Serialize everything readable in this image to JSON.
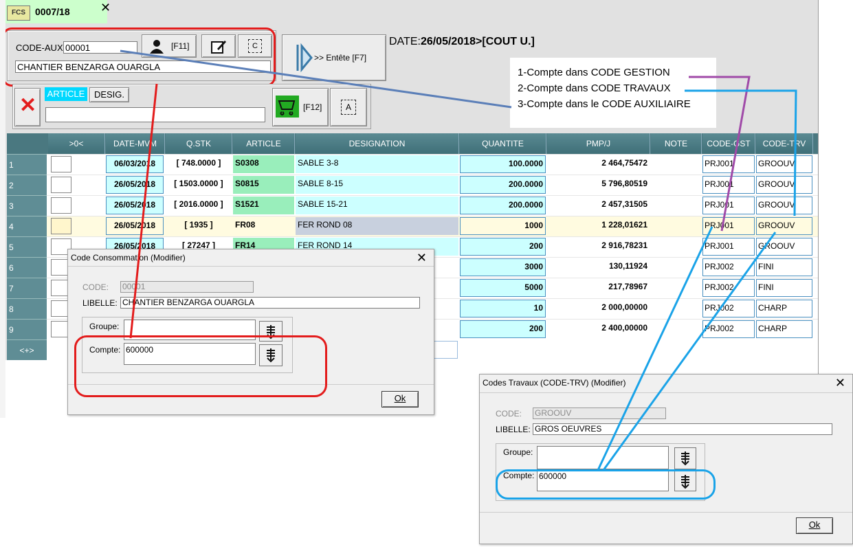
{
  "tab": {
    "title": "0007/18",
    "close": "✕",
    "icon": "FCS"
  },
  "header": {
    "code_aux_label": "CODE-AUX:",
    "code_aux_value": "00001",
    "client_name": "CHANTIER BENZARGA OUARGLA",
    "f11": "[F11]",
    "entete_btn": ">> Entête [F7]",
    "date_label": "DATE:",
    "date_value": "26/05/2018>[COUT U.]",
    "article_tab": "ARTICLE",
    "desig_tab": "DESIG.",
    "f12": "[F12]",
    "btn_c": "C",
    "btn_a": "A"
  },
  "annotation": [
    "1-Compte dans CODE GESTION",
    "2-Compte dans CODE TRAVAUX",
    "3-Compte dans le CODE AUXILIAIRE"
  ],
  "grid": {
    "columns": [
      ">0<",
      "DATE-MVM",
      "Q.STK",
      "ARTICLE",
      "DESIGNATION",
      "QUANTITE",
      "PMP/J",
      "NOTE",
      "CODE-GST",
      "CODE-TRV"
    ],
    "rows": [
      {
        "n": "1",
        "date": "06/03/2018",
        "qstk": "[ 748.0000 ]",
        "article": "S0308",
        "desig": "SABLE 3-8",
        "qte": "100.0000",
        "pmp": "2 464,75472",
        "note": "",
        "gst": "PRJ001",
        "trv": "GROOUV"
      },
      {
        "n": "2",
        "date": "26/05/2018",
        "qstk": "[ 1503.0000 ]",
        "article": "S0815",
        "desig": "SABLE 8-15",
        "qte": "200.0000",
        "pmp": "5 796,80519",
        "note": "",
        "gst": "PRJ001",
        "trv": "GROOUV"
      },
      {
        "n": "3",
        "date": "26/05/2018",
        "qstk": "[ 2016.0000 ]",
        "article": "S1521",
        "desig": "SABLE 15-21",
        "qte": "200.0000",
        "pmp": "2 457,31505",
        "note": "",
        "gst": "PRJ001",
        "trv": "GROOUV"
      },
      {
        "n": "4",
        "date": "26/05/2018",
        "qstk": "[ 1935 ]",
        "article": "FR08",
        "desig": "FER ROND 08",
        "qte": "1000",
        "pmp": "1 228,01621",
        "note": "",
        "gst": "PRJ001",
        "trv": "GROOUV"
      },
      {
        "n": "5",
        "date": "26/05/2018",
        "qstk": "[ 27247 ]",
        "article": "FR14",
        "desig": "FER ROND 14",
        "qte": "200",
        "pmp": "2 916,78231",
        "note": "",
        "gst": "PRJ001",
        "trv": "GROOUV"
      },
      {
        "n": "6",
        "date": "",
        "qstk": "",
        "article": "",
        "desig": "",
        "qte": "3000",
        "pmp": "130,11924",
        "note": "",
        "gst": "PRJ002",
        "trv": "FINI"
      },
      {
        "n": "7",
        "date": "",
        "qstk": "",
        "article": "",
        "desig": "",
        "qte": "5000",
        "pmp": "217,78967",
        "note": "",
        "gst": "PRJ002",
        "trv": "FINI"
      },
      {
        "n": "8",
        "date": "",
        "qstk": "",
        "article": "",
        "desig": "",
        "qte": "10",
        "pmp": "2 000,00000",
        "note": "",
        "gst": "PRJ002",
        "trv": "CHARP"
      },
      {
        "n": "9",
        "date": "",
        "qstk": "",
        "article": "",
        "desig": "",
        "qte": "200",
        "pmp": "2 400,00000",
        "note": "",
        "gst": "PRJ002",
        "trv": "CHARP"
      }
    ],
    "footer": "<+>"
  },
  "dialog_conso": {
    "title": "Code Consommation  (Modifier)",
    "code_label": "CODE:",
    "code_value": "00001",
    "libelle_label": "LIBELLE:",
    "libelle_value": "CHANTIER BENZARGA OUARGLA",
    "groupe_label": "Groupe:",
    "groupe_value": "",
    "compte_label": "Compte:",
    "compte_value": "600000",
    "ok": "Ok"
  },
  "dialog_trv": {
    "title": "Codes Travaux (CODE-TRV)  (Modifier)",
    "code_label": "CODE:",
    "code_value": "GROOUV",
    "libelle_label": "LIBELLE:",
    "libelle_value": "GROS OEUVRES",
    "groupe_label": "Groupe:",
    "groupe_value": "",
    "compte_label": "Compte:",
    "compte_value": "600000",
    "ok": "Ok"
  },
  "colors": {
    "red": "#e31c1c",
    "blue": "#1aa3e8",
    "purple": "#a04aa8",
    "steel": "#5b7fb8"
  }
}
